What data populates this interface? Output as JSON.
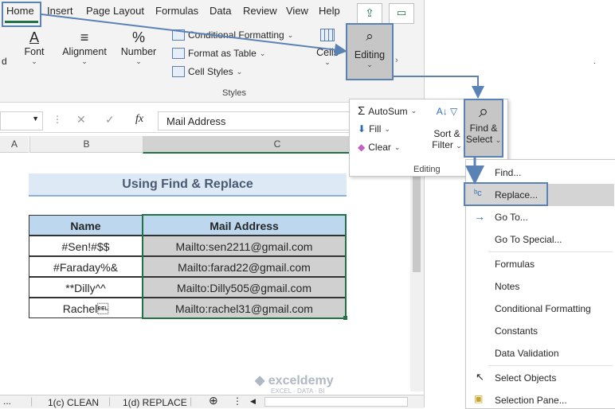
{
  "tabs": [
    "Home",
    "Insert",
    "Page Layout",
    "Formulas",
    "Data",
    "Review",
    "View",
    "Help"
  ],
  "ribbon": {
    "font_label": "Font",
    "alignment_label": "Alignment",
    "number_label": "Number",
    "cond_format": "Conditional Formatting",
    "format_table": "Format as Table",
    "cell_styles": "Cell Styles",
    "styles_label": "Styles",
    "cells_label": "Cells",
    "editing_label": "Editing",
    "number_icon": "%"
  },
  "formula_bar": {
    "fx": "fx",
    "value": "Mail Address"
  },
  "columns": [
    "A",
    "B",
    "C"
  ],
  "sheet": {
    "title": "Using Find & Replace",
    "headers": [
      "Name",
      "Mail Address"
    ],
    "rows": [
      [
        "#Sen!#$$",
        "Mailto:sen2211@gmail.com"
      ],
      [
        "#Faraday%&",
        "Mailto:farad22@gmail.com"
      ],
      [
        "**Dilly^^",
        "Mailto:Dilly505@gmail.com"
      ],
      [
        "Rachel\u0007",
        "Mailto:rachel31@gmail.com"
      ]
    ]
  },
  "sheet_tabs": [
    "1(c) CLEAN",
    "1(d) REPLACE"
  ],
  "editing_panel": {
    "autosum": "AutoSum",
    "fill": "Fill",
    "clear": "Clear",
    "sort_filter_1": "Sort &",
    "sort_filter_2": "Filter",
    "find_select_1": "Find &",
    "find_select_2": "Select",
    "group_label": "Editing"
  },
  "find_menu": [
    "Find...",
    "Replace...",
    "Go To...",
    "Go To Special...",
    "Formulas",
    "Notes",
    "Conditional Formatting",
    "Constants",
    "Data Validation",
    "Select Objects",
    "Selection Pane..."
  ],
  "watermark": {
    "brand": "exceldemy",
    "tagline": "EXCEL · DATA · BI"
  },
  "colors": {
    "accent": "#5b82b5",
    "header_fill": "#bdd7ee",
    "selected_fill": "#d0d0d0",
    "excel_green": "#217346"
  }
}
